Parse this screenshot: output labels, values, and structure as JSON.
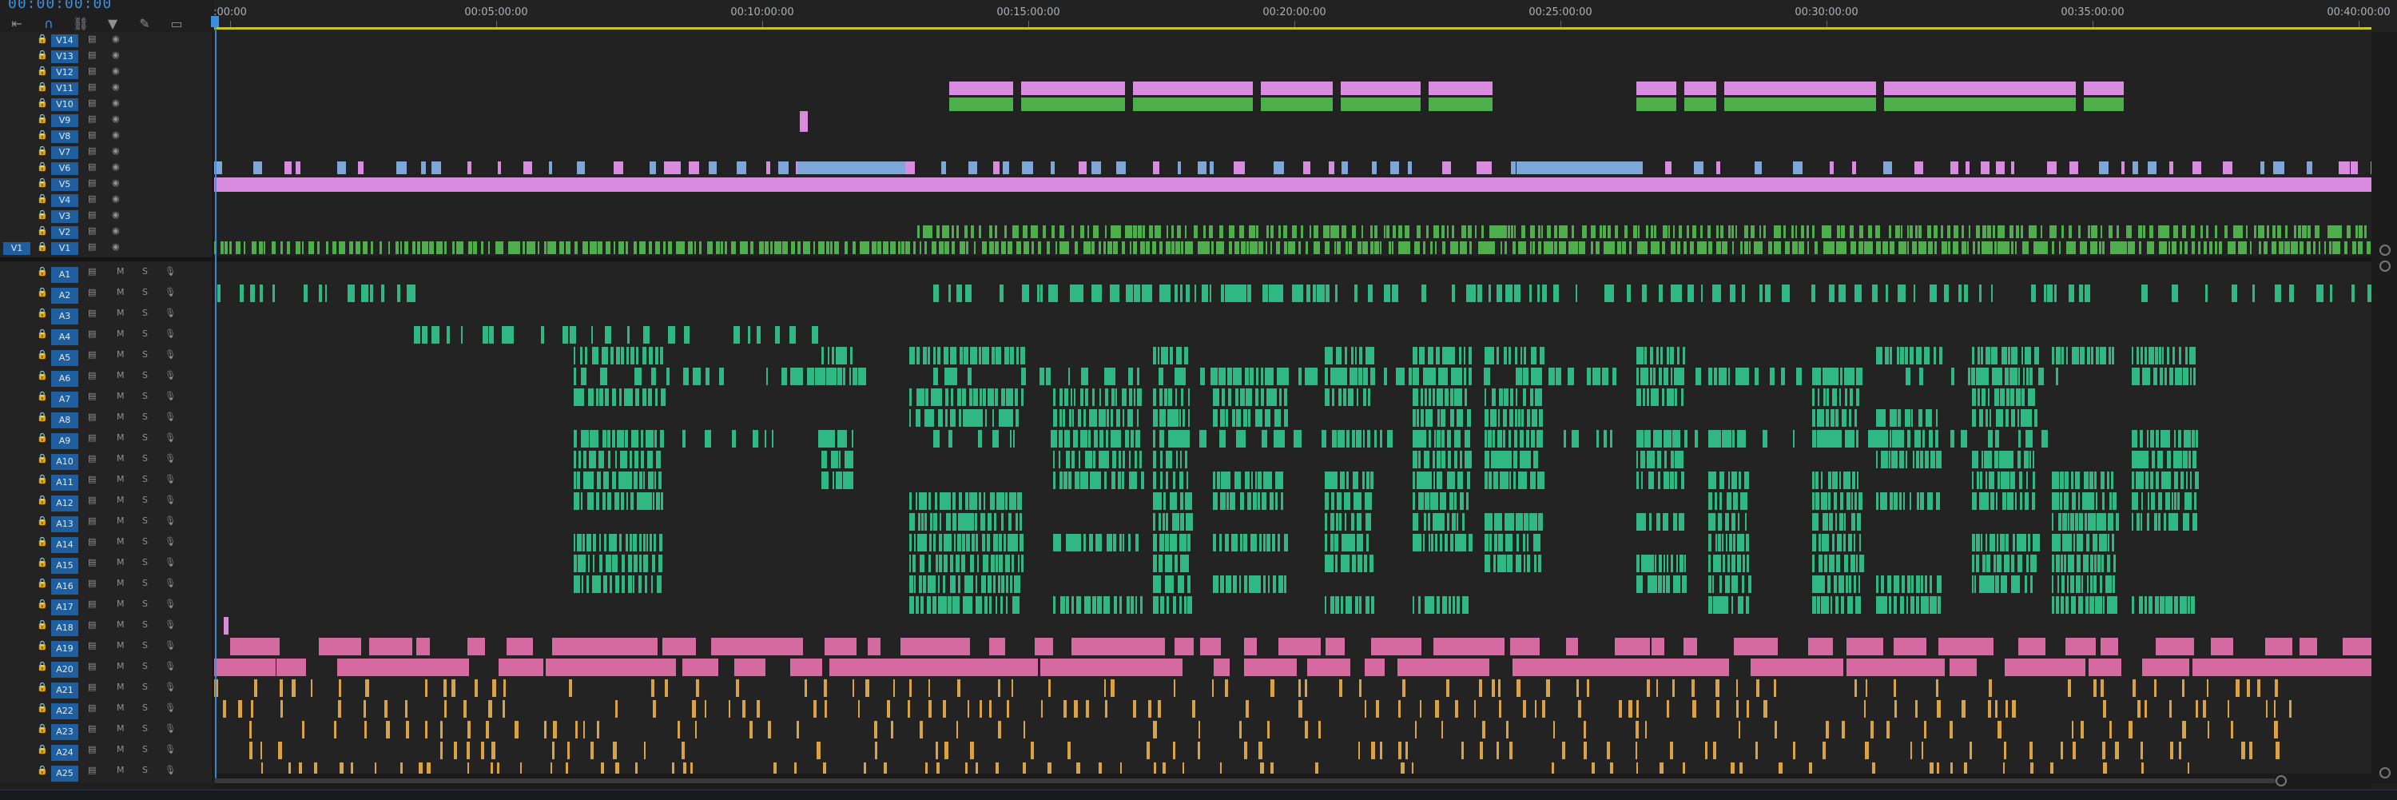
{
  "timecode": "00:00:00:00",
  "toolbar": {
    "icons": [
      "wrap-icon",
      "snap-icon",
      "linked-selection-icon",
      "add-marker-icon",
      "settings-wrench-icon",
      "captions-icon"
    ]
  },
  "ruler": {
    "labels": [
      ":00:00",
      "00:05:00:00",
      "00:10:00:00",
      "00:15:00:00",
      "00:20:00:00",
      "00:25:00:00",
      "00:30:00:00",
      "00:35:00:00",
      "00:40:00:00"
    ]
  },
  "video_tracks": [
    "V14",
    "V13",
    "V12",
    "V11",
    "V10",
    "V9",
    "V8",
    "V7",
    "V6",
    "V5",
    "V4",
    "V3",
    "V2",
    "V1"
  ],
  "video_source_patch": "V1",
  "audio_tracks": [
    "A1",
    "A2",
    "A3",
    "A4",
    "A5",
    "A6",
    "A7",
    "A8",
    "A9",
    "A10",
    "A11",
    "A12",
    "A13",
    "A14",
    "A15",
    "A16",
    "A17",
    "A18",
    "A19",
    "A20",
    "A21",
    "A22",
    "A23",
    "A24",
    "A25"
  ],
  "audio_controls": {
    "mute": "M",
    "solo": "S"
  },
  "colors": {
    "accent": "#3b8fe0",
    "video_pink": "#d98be0",
    "video_green": "#4fae4c",
    "video_blue": "#7fa6d8",
    "audio_teal": "#2fb883",
    "audio_pink": "#d46aa0",
    "audio_orange": "#d9a245",
    "work_area": "#c8c22b"
  }
}
